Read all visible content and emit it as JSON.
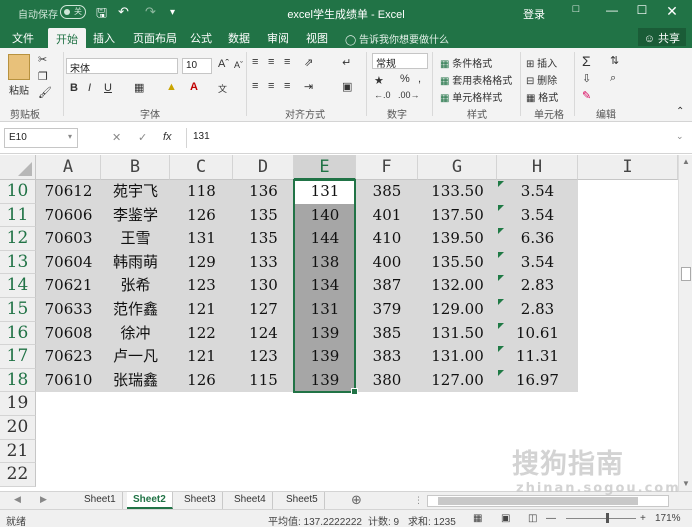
{
  "titlebar": {
    "autosave_label": "自动保存",
    "autosave_state": "关",
    "title": "excel学生成绩单 - Excel",
    "login": "登录"
  },
  "tabs": [
    "文件",
    "开始",
    "插入",
    "页面布局",
    "公式",
    "数据",
    "审阅",
    "视图"
  ],
  "active_tab": "开始",
  "tellme": "告诉我你想要做什么",
  "share": "共享",
  "ribbon": {
    "paste": "粘贴",
    "clipboard": "剪贴板",
    "font_name": "宋体",
    "font_size": "10",
    "font_group": "字体",
    "align_group": "对齐方式",
    "number_format": "常规",
    "number_group": "数字",
    "cond_format": "条件格式",
    "table_format": "套用表格格式",
    "cell_style": "单元格样式",
    "style_group": "样式",
    "insert": "插入",
    "delete": "删除",
    "format": "格式",
    "cells_group": "单元格",
    "edit_group": "编辑",
    "bold": "B",
    "italic": "I",
    "underline": "U",
    "percent": "%",
    "comma": ","
  },
  "formula_bar": {
    "name_box": "E10",
    "fx": "fx",
    "value": "131"
  },
  "columns": [
    "A",
    "B",
    "C",
    "D",
    "E",
    "F",
    "G",
    "H",
    "I"
  ],
  "rows": [
    {
      "n": "10",
      "cells": [
        "70612",
        "苑宇飞",
        "118",
        "136",
        "131",
        "385",
        "133.50",
        "3.54"
      ]
    },
    {
      "n": "11",
      "cells": [
        "70606",
        "李鉴学",
        "126",
        "135",
        "140",
        "401",
        "137.50",
        "3.54"
      ]
    },
    {
      "n": "12",
      "cells": [
        "70603",
        "王雪",
        "131",
        "135",
        "144",
        "410",
        "139.50",
        "6.36"
      ]
    },
    {
      "n": "13",
      "cells": [
        "70604",
        "韩雨萌",
        "129",
        "133",
        "138",
        "400",
        "135.50",
        "3.54"
      ]
    },
    {
      "n": "14",
      "cells": [
        "70621",
        "张希",
        "123",
        "130",
        "134",
        "387",
        "132.00",
        "2.83"
      ]
    },
    {
      "n": "15",
      "cells": [
        "70633",
        "范作鑫",
        "121",
        "127",
        "131",
        "379",
        "129.00",
        "2.83"
      ]
    },
    {
      "n": "16",
      "cells": [
        "70608",
        "徐冲",
        "122",
        "124",
        "139",
        "385",
        "131.50",
        "10.61"
      ]
    },
    {
      "n": "17",
      "cells": [
        "70623",
        "卢一凡",
        "121",
        "123",
        "139",
        "383",
        "131.00",
        "11.31"
      ]
    },
    {
      "n": "18",
      "cells": [
        "70610",
        "张瑞鑫",
        "126",
        "115",
        "139",
        "380",
        "127.00",
        "16.97"
      ]
    },
    {
      "n": "19",
      "cells": []
    },
    {
      "n": "20",
      "cells": []
    },
    {
      "n": "21",
      "cells": []
    },
    {
      "n": "22",
      "cells": []
    }
  ],
  "sheets": [
    "Sheet1",
    "Sheet2",
    "Sheet3",
    "Sheet4",
    "Sheet5"
  ],
  "active_sheet": "Sheet2",
  "status": {
    "mode": "就绪",
    "average": "平均值: 137.2222222",
    "count": "计数: 9",
    "sum": "求和: 1235",
    "zoom": "171%"
  },
  "watermark": {
    "main": "搜狗指南",
    "sub": "zhinan.sogou.com"
  },
  "colors": {
    "excel_green": "#217346",
    "selection_gray": "#a6a6a6",
    "highlight_gray": "#d9d9d9"
  }
}
